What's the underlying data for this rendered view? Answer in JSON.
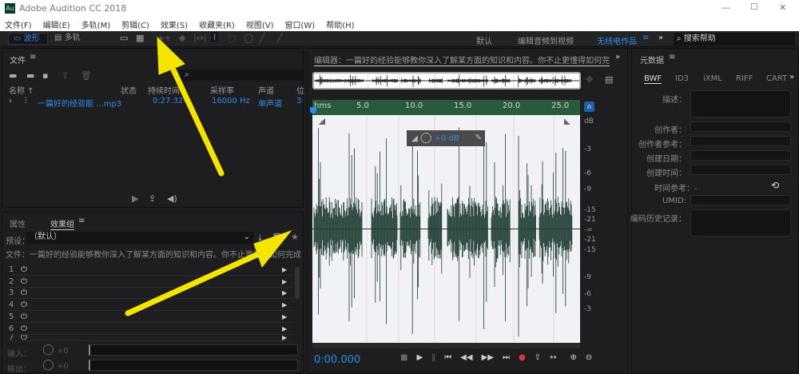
{
  "app": {
    "title": "Adobe Audition CC 2018",
    "logo": "Au"
  },
  "window_controls": {
    "minimize": "—",
    "maximize": "☐",
    "close": "✕"
  },
  "menu": [
    "文件(F)",
    "编辑(E)",
    "多轨(M)",
    "剪辑(C)",
    "效果(S)",
    "收藏夹(R)",
    "视图(V)",
    "窗口(W)",
    "帮助(H)"
  ],
  "toolbar": {
    "waveform": "波形",
    "multitrack": "多轨",
    "workspaces": [
      "默认",
      "编辑音频到视频",
      "无线电作品"
    ],
    "active_workspace": "无线电作品",
    "search_placeholder": "搜索帮助"
  },
  "files": {
    "title": "文件",
    "columns": [
      "名称 ↑",
      "状态",
      "持续时间",
      "采样率",
      "声道",
      "位"
    ],
    "rows": [
      {
        "name": "一篇好的经验能 ...mp3",
        "status": "",
        "duration": "0:27.324",
        "rate": "16000 Hz",
        "channels": "单声道",
        "bits": "3"
      }
    ]
  },
  "effects": {
    "tabs": [
      "属性",
      "效果组"
    ],
    "active_tab": "效果组",
    "preset_label": "预设：",
    "preset_value": "（默认）",
    "file_line": "文件：一篇好的经验能够教你深入了解某方面的知识和内容。你不止更懂得如何完成任 ...",
    "slots": [
      "1",
      "2",
      "3",
      "4",
      "5",
      "6",
      "7"
    ],
    "input_label": "输入：",
    "output_label": "输出：",
    "input_gain": "+0",
    "output_gain": "+0"
  },
  "editor": {
    "title": "编辑器：一篇好的经验能够教你深入了解某方面的知识和内容。你不止更懂得如何完成任",
    "ruler": [
      "hms",
      "5.0",
      "10.0",
      "15.0",
      "20.0",
      "25.0"
    ],
    "db_scale": [
      "dB",
      "-3",
      "-6",
      "-9",
      "-15",
      "-21",
      "-∞",
      "-21",
      "-15",
      "-9",
      "-6",
      "-3"
    ],
    "gain_hud": "+0 dB",
    "time": "0:00.000",
    "waveform_color": "#1f3d33",
    "ruler_color": "#2a5a3c"
  },
  "metadata": {
    "title": "元数据",
    "tabs": [
      "BWF",
      "ID3",
      "iXML",
      "RIFF",
      "CART"
    ],
    "active_tab": "BWF",
    "fields": [
      "描述：",
      "创作者：",
      "创作者参考：",
      "创建日期：",
      "创建时间：",
      "时间参考：-",
      "UMID:",
      "编码历史记录："
    ]
  },
  "annotation": {
    "arrow_color": "#f5e300"
  }
}
